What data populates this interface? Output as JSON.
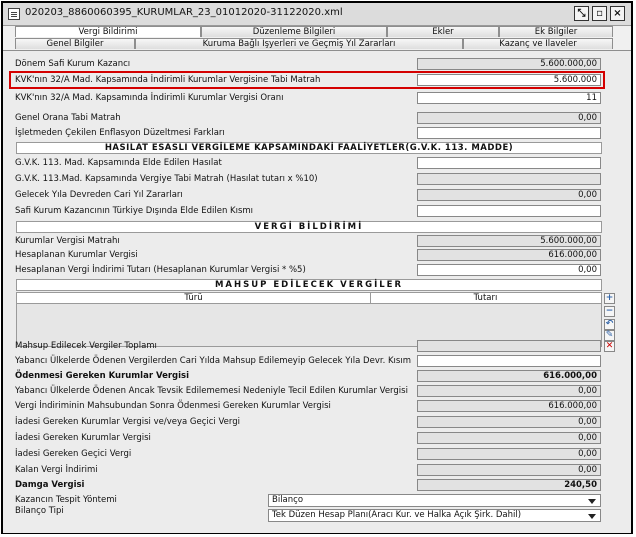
{
  "window": {
    "title": "020203_8860060395_KURUMLAR_23_01012020-31122020.xml",
    "buttons": {
      "dock": "⤡",
      "restore": "▫",
      "close": "×"
    }
  },
  "tabs_top": [
    {
      "label": "Vergi Bildirimi",
      "active": true
    },
    {
      "label": "Düzenleme Bilgileri",
      "active": false
    },
    {
      "label": "Ekler",
      "active": false
    },
    {
      "label": "Ek Bilgiler",
      "active": false
    }
  ],
  "tabs_bottom": [
    {
      "label": "Genel Bilgiler"
    },
    {
      "label": "Kuruma Bağlı İşyerleri ve Geçmiş Yıl Zararları"
    },
    {
      "label": "Kazanç ve İlaveler"
    }
  ],
  "rows": {
    "donem_safi": {
      "label": "Dönem Safi Kurum Kazancı",
      "value": "5.600.000,00"
    },
    "kvk_matrah": {
      "label": "KVK'nın 32/A Mad. Kapsamında İndirimli Kurumlar Vergisine Tabi Matrah",
      "value": "5.600.000"
    },
    "kvk_oran": {
      "label": "KVK'nın 32/A Mad. Kapsamında İndirimli Kurumlar Vergisi Oranı",
      "value": "11"
    },
    "genel_oran": {
      "label": "Genel Orana Tabi Matrah",
      "value": "0,00"
    },
    "enflasyon": {
      "label": "İşletmeden Çekilen Enflasyon Düzeltmesi Farkları",
      "value": ""
    },
    "gvk_hasilat": {
      "label": "G.V.K. 113. Mad. Kapsamında Elde Edilen Hasılat",
      "value": ""
    },
    "gvk_matrah": {
      "label": "G.V.K. 113.Mad. Kapsamında Vergiye Tabi Matrah (Hasılat tutarı x %10)",
      "value": ""
    },
    "gelecek_yil": {
      "label": "Gelecek Yıla Devreden Cari Yıl Zararları",
      "value": "0,00"
    },
    "safi_kurum_disi": {
      "label": "Safi Kurum Kazancının Türkiye Dışında Elde Edilen Kısmı",
      "value": ""
    },
    "kv_matrahi": {
      "label": "Kurumlar Vergisi Matrahı",
      "value": "5.600.000,00"
    },
    "hesaplanan_kv": {
      "label": "Hesaplanan Kurumlar Vergisi",
      "value": "616.000,00"
    },
    "indirim_tutari": {
      "label": "Hesaplanan Vergi İndirimi Tutarı (Hesaplanan Kurumlar Vergisi * %5)",
      "value": "0,00"
    },
    "mahsup_toplami": {
      "label": "Mahsup Edilecek Vergiler Toplamı",
      "value": ""
    },
    "yabanci_mahsup": {
      "label": "Yabancı Ülkelerde Ödenen Vergilerden Cari Yılda Mahsup Edilemeyip Gelecek Yıla Devr. Kısım",
      "value": ""
    },
    "odenmesi_gereken": {
      "label": "Ödenmesi Gereken Kurumlar Vergisi",
      "value": "616.000,00"
    },
    "tecil": {
      "label": "Yabancı Ülkelerde Ödenen Ancak Tevsik Edilememesi Nedeniyle Tecil Edilen Kurumlar Vergisi",
      "value": "0,00"
    },
    "indirim_sonra": {
      "label": "Vergi İndiriminin Mahsubundan Sonra Ödenmesi Gereken Kurumlar Vergisi",
      "value": "616.000,00"
    },
    "iade_kv_gecici": {
      "label": "İadesi Gereken Kurumlar Vergisi ve/veya Geçici Vergi",
      "value": "0,00"
    },
    "iade_kv": {
      "label": "İadesi Gereken Kurumlar Vergisi",
      "value": "0,00"
    },
    "iade_gecici": {
      "label": "İadesi Gereken Geçici Vergi",
      "value": "0,00"
    },
    "kalan_indirim": {
      "label": "Kalan Vergi İndirimi",
      "value": "0,00"
    },
    "damga": {
      "label": "Damga Vergisi",
      "value": "240,50"
    }
  },
  "sections": {
    "hasilat": "HASILAT ESASLI VERGİLEME KAPSAMINDAKİ FAALİYETLER(G.V.K. 113. MADDE)",
    "vergi_bildirimi": "VERGİ BİLDİRİMİ",
    "mahsup": "MAHSUP EDİLECEK VERGİLER"
  },
  "grid": {
    "columns": [
      "Türü",
      "Tutarı"
    ]
  },
  "grid_tools": {
    "add": "+",
    "remove": "−",
    "undo": "↶",
    "edit": "✎",
    "delete": "✕"
  },
  "selects": {
    "kazanc_label": "Kazancın Tespit Yöntemi",
    "kazanc_value": "Bilanço",
    "bilanco_label": "Bilanço Tipi",
    "bilanco_value": "Tek Düzen Hesap Planı(Aracı Kur. ve Halka Açık Şirk. Dahil)"
  },
  "colors": {
    "highlight": "#d40000"
  }
}
